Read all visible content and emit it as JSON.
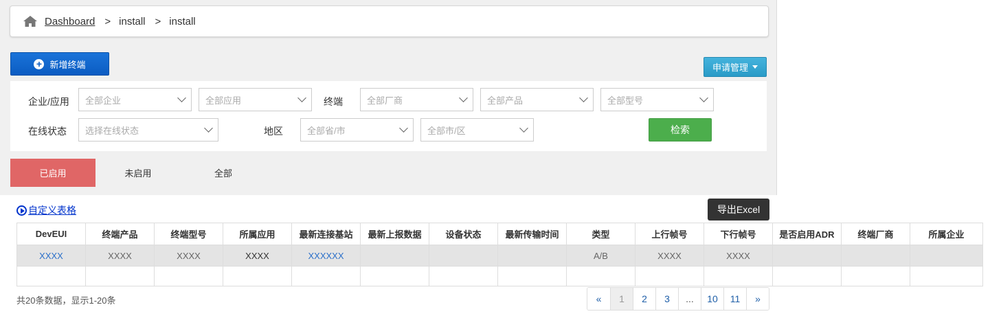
{
  "breadcrumb": {
    "home_icon": "home-icon",
    "items": [
      "Dashboard",
      "install",
      "install"
    ],
    "separator": ">"
  },
  "toolbar": {
    "add_label": "新增终端",
    "apply_label": "申请管理"
  },
  "filters": {
    "org_app_label": "企业/应用",
    "org_placeholder": "全部企业",
    "app_placeholder": "全部应用",
    "terminal_label": "终端",
    "vendor_placeholder": "全部厂商",
    "product_placeholder": "全部产品",
    "model_placeholder": "全部型号",
    "online_label": "在线状态",
    "online_placeholder": "选择在线状态",
    "region_label": "地区",
    "province_placeholder": "全部省/市",
    "city_placeholder": "全部市/区",
    "search_label": "检索"
  },
  "tabs": [
    "已启用",
    "未启用",
    "全部"
  ],
  "custom_table_label": "自定义表格",
  "export_label": "导出Excel",
  "table": {
    "columns": [
      "DevEUI",
      "终端产品",
      "终端型号",
      "所属应用",
      "最新连接基站",
      "最新上报数据",
      "设备状态",
      "最新传输时间",
      "类型",
      "上行帧号",
      "下行帧号",
      "是否启用ADR",
      "终端厂商",
      "所属企业"
    ],
    "rows": [
      [
        "XXXX",
        "XXXX",
        "XXXX",
        "XXXX",
        "XXXXXX",
        "",
        "",
        "",
        "A/B",
        "XXXX",
        "XXXX",
        "",
        "",
        ""
      ]
    ]
  },
  "summary": "共20条数据，显示1-20条",
  "pagination": [
    "«",
    "1",
    "2",
    "3",
    "...",
    "10",
    "11",
    "»"
  ],
  "colors": {
    "primary": "#0b5cc2",
    "info": "#2a9bc7",
    "success": "#4cae4c",
    "active_tab": "#e06666",
    "dark_button": "#333333"
  }
}
